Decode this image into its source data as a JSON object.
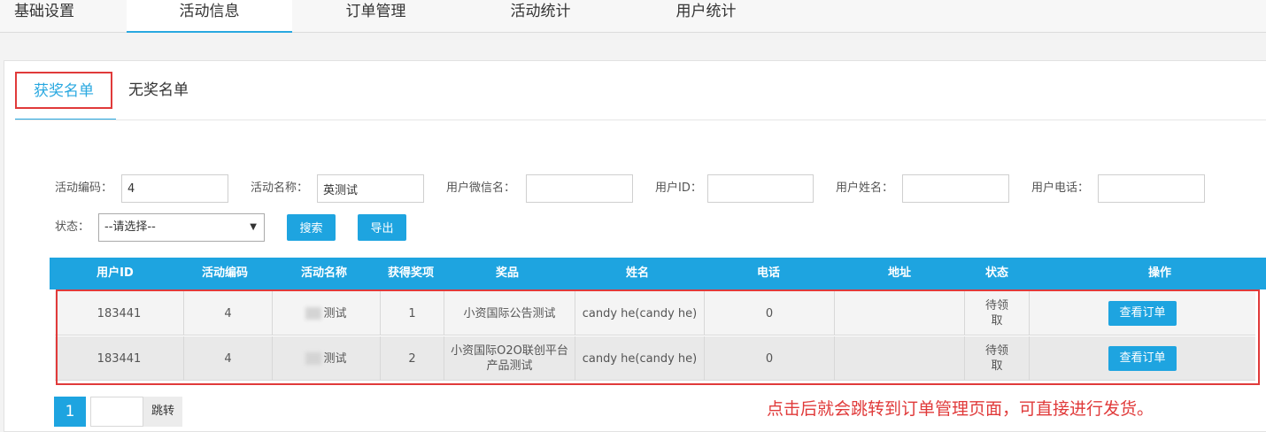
{
  "top_tabs": [
    "基础设置",
    "活动信息",
    "订单管理",
    "活动统计",
    "用户统计"
  ],
  "sub_tabs": {
    "winners": "获奖名单",
    "non_winners": "无奖名单"
  },
  "filters": {
    "activity_code_label": "活动编码：",
    "activity_code_value": "4",
    "activity_name_label": "活动名称：",
    "activity_name_value": "英测试",
    "wechat_name_label": "用户微信名：",
    "user_id_label": "用户ID：",
    "user_name_label": "用户姓名：",
    "user_phone_label": "用户电话：",
    "status_label": "状态：",
    "status_selected": "--请选择--",
    "search_button": "搜索",
    "export_button": "导出"
  },
  "table": {
    "headers": [
      "用户ID",
      "活动编码",
      "活动名称",
      "获得奖项",
      "奖品",
      "姓名",
      "电话",
      "地址",
      "状态",
      "操作"
    ],
    "rows": [
      {
        "user_id": "183441",
        "code": "4",
        "name": "测试",
        "award": "1",
        "prize": "小资国际公告测试",
        "person": "candy he(candy he)",
        "phone": "0",
        "address": "",
        "status": "待领取",
        "action": "查看订单"
      },
      {
        "user_id": "183441",
        "code": "4",
        "name": "测试",
        "award": "2",
        "prize": "小资国际O2O联创平台 产品测试",
        "person": "candy he(candy he)",
        "phone": "0",
        "address": "",
        "status": "待领取",
        "action": "查看订单"
      }
    ]
  },
  "pagination": {
    "current_page": "1",
    "go_label": "跳转"
  },
  "annotation": "点击后就会跳转到订单管理页面，可直接进行发货。",
  "colors": {
    "accent": "#1ea4e0",
    "highlight": "#e03a3a"
  }
}
